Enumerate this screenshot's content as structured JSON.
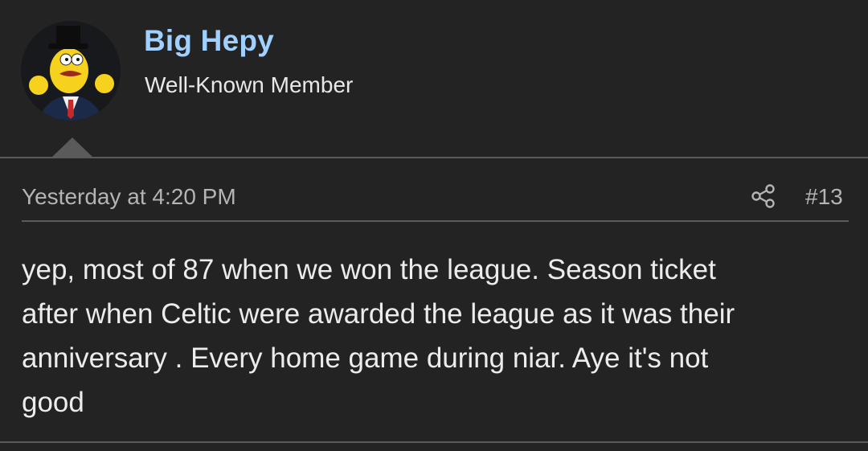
{
  "user": {
    "name": "Big Hepy",
    "title": "Well-Known Member",
    "avatar_icon": "cartoon-character-top-hat-avatar"
  },
  "post": {
    "timestamp": "Yesterday at 4:20 PM",
    "number": "#13",
    "share_icon": "share-icon",
    "text": "yep, most of 87 when we won the league. Season ticket\nafter when Celtic were awarded the league as it was their\nanniversary . Every home game during niar. Aye it's not\ngood"
  },
  "colors": {
    "background": "#232323",
    "username": "#9fd0ff",
    "text": "#ececec",
    "muted": "#b4b4b4",
    "divider": "#5a5a5a"
  }
}
